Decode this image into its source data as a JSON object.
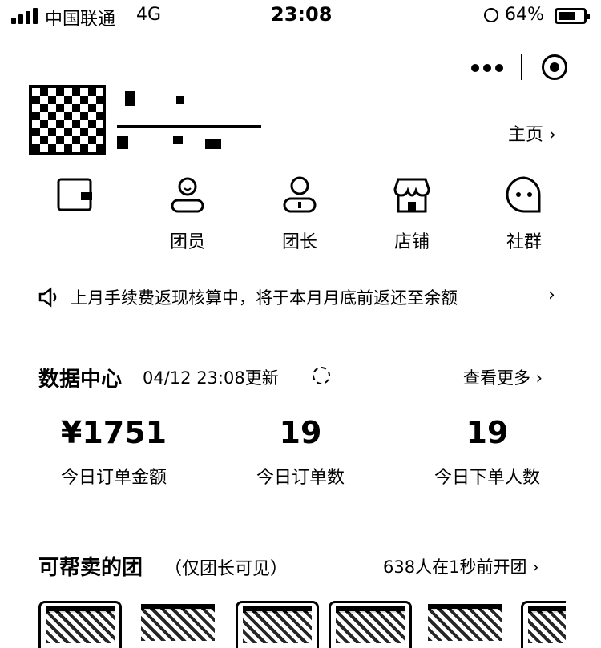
{
  "status_bar": {
    "carrier": "中国联通",
    "network": "4G",
    "time": "23:08",
    "battery": "64%",
    "battery_level": 0.64
  },
  "header": {
    "home_link": "主页 ›"
  },
  "nav": [
    {
      "label": "",
      "icon": "wallet-icon"
    },
    {
      "label": "团员",
      "icon": "member-icon"
    },
    {
      "label": "团长",
      "icon": "leader-icon"
    },
    {
      "label": "店铺",
      "icon": "shop-icon"
    },
    {
      "label": "社群",
      "icon": "community-icon"
    }
  ],
  "notice": {
    "text": "上月手续费返现核算中，将于本月月底前返还至余额",
    "icon": "speaker-icon"
  },
  "data_center": {
    "title": "数据中心",
    "updated": "04/12 23:08更新",
    "more": "查看更多 ›",
    "stats": [
      {
        "value": "¥1751",
        "label": "今日订单金额"
      },
      {
        "value": "19",
        "label": "今日订单数"
      },
      {
        "value": "19",
        "label": "今日下单人数"
      }
    ]
  },
  "groups": {
    "title": "可帮卖的团",
    "note": "（仅团长可见）",
    "recent": "638人在1秒前开团 ›"
  }
}
